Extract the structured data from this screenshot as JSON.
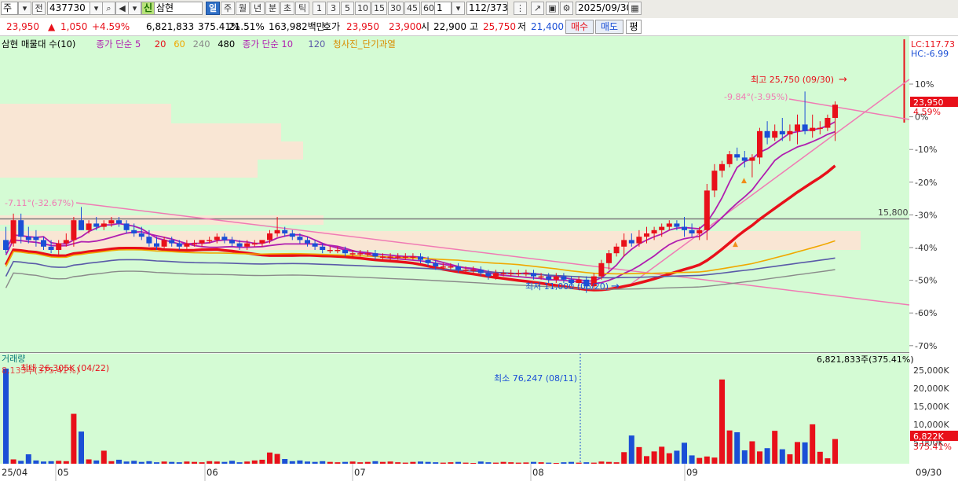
{
  "toolbar": {
    "market_type": "주",
    "prev_label": "전",
    "stock_code": "437730",
    "credit_badge": "신",
    "stock_name": "삼현",
    "periods": [
      "일",
      "주",
      "월",
      "년",
      "분",
      "초",
      "틱"
    ],
    "active_period": "일",
    "intervals": [
      "1",
      "3",
      "5",
      "10",
      "15",
      "30",
      "45",
      "60"
    ],
    "step_value": "1",
    "page_count": "112",
    "page_total": "/373",
    "date": "2025/09/30"
  },
  "quote": {
    "price": "23,950",
    "change_arrow": "▲",
    "change": "1,050",
    "change_rate": "+4.59%",
    "volume": "6,821,833",
    "volume_ratio": "375.41%",
    "turnover": "21.51%",
    "trade_value": "163,982백만",
    "ask_label": "호가",
    "ask": "23,950",
    "bid": "23,900",
    "open_label": "시",
    "open": "22,900",
    "high_label": "고",
    "high": "25,750",
    "low_label": "저",
    "low": "21,400",
    "buy_label": "매수",
    "sell_label": "매도",
    "eval_label": "평"
  },
  "price_panel": {
    "legend": [
      {
        "text": "삼현 매물대 수(10)",
        "color": "#000000"
      },
      {
        "text": "종가 단순 5",
        "color": "#b01eb0"
      },
      {
        "text": "20",
        "color": "#e8101a"
      },
      {
        "text": "60",
        "color": "#f0a800"
      },
      {
        "text": "240",
        "color": "#8a8a8a"
      },
      {
        "text": "480",
        "color": "#000000"
      },
      {
        "text": "종가 단순 10",
        "color": "#b01eb0"
      },
      {
        "text": "120",
        "color": "#5a5aa8"
      },
      {
        "text": "청사진_단기과열",
        "color": "#d98c00"
      }
    ],
    "lc_label": "LC:117.73",
    "hc_label": "HC:-6.99",
    "y_axis_ticks": [
      "10%",
      "0%",
      "-10%",
      "-20%",
      "-30%",
      "-40%",
      "-50%",
      "-60%",
      "-70%"
    ],
    "price_badge": "23,950",
    "rate_badge": "4.59%",
    "hline_label": "15,800",
    "high_annotation": "최고 25,750 (09/30)",
    "low_annotation": "최저 11,000 (08/20)",
    "trend_label_left": "-7.11°(-32.67%)",
    "trend_label_right": "-9.84°(-3.95%)",
    "colors": {
      "up": "#e8101a",
      "down": "#1b4fd6",
      "background": "#d4fbd4"
    }
  },
  "volume_panel": {
    "title": "거래량",
    "max_annotation": "최대 26,305K (04/22)",
    "left_value": "8,133주(375.41%)",
    "right_top_value": "6,821,833주(375.41%)",
    "min_annotation": "최소 76,247 (08/11)",
    "y_axis_ticks": [
      "25,000K",
      "20,000K",
      "15,000K",
      "10,000K",
      "5,000K"
    ],
    "volume_badge": "6,822K",
    "rate_badge": "375.41%"
  },
  "x_axis": {
    "labels": [
      "25/04",
      "05",
      "06",
      "07",
      "08",
      "09",
      "09/30"
    ]
  },
  "chart_data": {
    "type": "candlestick",
    "period": "daily",
    "x_range": [
      "2025/04",
      "2025/09/30"
    ],
    "y_axis": {
      "unit": "% relative",
      "ticks": [
        10,
        0,
        -10,
        -20,
        -30,
        -40,
        -50,
        -60,
        -70
      ]
    },
    "candles_ohlc": [
      {
        "o": -37,
        "h": -33,
        "l": -41,
        "c": -40
      },
      {
        "o": -38,
        "h": -29,
        "l": -39,
        "c": -31
      },
      {
        "o": -31,
        "h": -29,
        "l": -38,
        "c": -36
      },
      {
        "o": -36,
        "h": -33,
        "l": -38,
        "c": -37
      },
      {
        "o": -36,
        "h": -34,
        "l": -39,
        "c": -37
      },
      {
        "o": -37,
        "h": -36,
        "l": -40,
        "c": -39
      },
      {
        "o": -39,
        "h": -37,
        "l": -41,
        "c": -40
      },
      {
        "o": -40,
        "h": -37,
        "l": -42,
        "c": -38
      },
      {
        "o": -38,
        "h": -35,
        "l": -39,
        "c": -37
      },
      {
        "o": -37,
        "h": -30,
        "l": -39,
        "c": -31
      },
      {
        "o": -31,
        "h": -27,
        "l": -34,
        "c": -34
      },
      {
        "o": -34,
        "h": -31,
        "l": -35,
        "c": -32
      },
      {
        "o": -32,
        "h": -30,
        "l": -34,
        "c": -33
      },
      {
        "o": -33,
        "h": -31,
        "l": -34,
        "c": -32
      },
      {
        "o": -32,
        "h": -30,
        "l": -33,
        "c": -31
      },
      {
        "o": -31,
        "h": -30,
        "l": -33,
        "c": -32
      },
      {
        "o": -32,
        "h": -31,
        "l": -35,
        "c": -34
      },
      {
        "o": -34,
        "h": -32,
        "l": -36,
        "c": -35
      },
      {
        "o": -35,
        "h": -33,
        "l": -37,
        "c": -36
      },
      {
        "o": -36,
        "h": -34,
        "l": -39,
        "c": -38
      },
      {
        "o": -38,
        "h": -36,
        "l": -40,
        "c": -39
      },
      {
        "o": -39,
        "h": -36,
        "l": -40,
        "c": -37
      },
      {
        "o": -37,
        "h": -36,
        "l": -39,
        "c": -38
      },
      {
        "o": -38,
        "h": -37,
        "l": -40,
        "c": -39
      },
      {
        "o": -39,
        "h": -37,
        "l": -40,
        "c": -38
      },
      {
        "o": -38,
        "h": -37,
        "l": -39,
        "c": -38
      },
      {
        "o": -38,
        "h": -37,
        "l": -39,
        "c": -37
      },
      {
        "o": -37,
        "h": -36,
        "l": -38,
        "c": -37
      },
      {
        "o": -37,
        "h": -35,
        "l": -38,
        "c": -36
      },
      {
        "o": -36,
        "h": -35,
        "l": -38,
        "c": -37
      },
      {
        "o": -37,
        "h": -36,
        "l": -39,
        "c": -38
      },
      {
        "o": -38,
        "h": -37,
        "l": -40,
        "c": -39
      },
      {
        "o": -39,
        "h": -37,
        "l": -40,
        "c": -38
      },
      {
        "o": -38,
        "h": -37,
        "l": -39,
        "c": -38
      },
      {
        "o": -38,
        "h": -37,
        "l": -39,
        "c": -37
      },
      {
        "o": -37,
        "h": -34,
        "l": -38,
        "c": -35
      },
      {
        "o": -35,
        "h": -30,
        "l": -36,
        "c": -34
      },
      {
        "o": -34,
        "h": -33,
        "l": -36,
        "c": -35
      },
      {
        "o": -35,
        "h": -34,
        "l": -37,
        "c": -36
      },
      {
        "o": -36,
        "h": -35,
        "l": -38,
        "c": -37
      },
      {
        "o": -37,
        "h": -36,
        "l": -39,
        "c": -38
      },
      {
        "o": -38,
        "h": -37,
        "l": -40,
        "c": -39
      },
      {
        "o": -39,
        "h": -38,
        "l": -41,
        "c": -40
      },
      {
        "o": -40,
        "h": -39,
        "l": -41,
        "c": -40
      },
      {
        "o": -40,
        "h": -39,
        "l": -41,
        "c": -40
      },
      {
        "o": -40,
        "h": -39,
        "l": -42,
        "c": -41
      },
      {
        "o": -41,
        "h": -40,
        "l": -42,
        "c": -41
      },
      {
        "o": -41,
        "h": -40,
        "l": -42,
        "c": -41
      },
      {
        "o": -41,
        "h": -40,
        "l": -42,
        "c": -41
      },
      {
        "o": -41,
        "h": -40,
        "l": -43,
        "c": -42
      },
      {
        "o": -42,
        "h": -41,
        "l": -43,
        "c": -42
      },
      {
        "o": -42,
        "h": -41,
        "l": -43,
        "c": -42
      },
      {
        "o": -42,
        "h": -41,
        "l": -43,
        "c": -42
      },
      {
        "o": -42,
        "h": -41,
        "l": -43,
        "c": -42
      },
      {
        "o": -42,
        "h": -41,
        "l": -43,
        "c": -42
      },
      {
        "o": -42,
        "h": -41,
        "l": -44,
        "c": -43
      },
      {
        "o": -43,
        "h": -42,
        "l": -45,
        "c": -44
      },
      {
        "o": -44,
        "h": -43,
        "l": -46,
        "c": -45
      },
      {
        "o": -45,
        "h": -44,
        "l": -46,
        "c": -45
      },
      {
        "o": -45,
        "h": -44,
        "l": -46,
        "c": -45
      },
      {
        "o": -45,
        "h": -44,
        "l": -47,
        "c": -46
      },
      {
        "o": -46,
        "h": -45,
        "l": -47,
        "c": -46
      },
      {
        "o": -46,
        "h": -45,
        "l": -47,
        "c": -46
      },
      {
        "o": -46,
        "h": -45,
        "l": -48,
        "c": -47
      },
      {
        "o": -47,
        "h": -46,
        "l": -49,
        "c": -48
      },
      {
        "o": -48,
        "h": -46,
        "l": -49,
        "c": -47
      },
      {
        "o": -47,
        "h": -46,
        "l": -48,
        "c": -47
      },
      {
        "o": -47,
        "h": -46,
        "l": -48,
        "c": -47
      },
      {
        "o": -47,
        "h": -46,
        "l": -48,
        "c": -47
      },
      {
        "o": -47,
        "h": -46,
        "l": -48,
        "c": -47
      },
      {
        "o": -47,
        "h": -46,
        "l": -49,
        "c": -48
      },
      {
        "o": -48,
        "h": -47,
        "l": -49,
        "c": -48
      },
      {
        "o": -48,
        "h": -47,
        "l": -50,
        "c": -49
      },
      {
        "o": -49,
        "h": -47,
        "l": -50,
        "c": -48
      },
      {
        "o": -48,
        "h": -47,
        "l": -50,
        "c": -49
      },
      {
        "o": -49,
        "h": -48,
        "l": -51,
        "c": -50
      },
      {
        "o": -50,
        "h": -48,
        "l": -51,
        "c": -49
      },
      {
        "o": -49,
        "h": -48,
        "l": -53,
        "c": -51
      },
      {
        "o": -51,
        "h": -47,
        "l": -52,
        "c": -48
      },
      {
        "o": -48,
        "h": -43,
        "l": -49,
        "c": -44
      },
      {
        "o": -44,
        "h": -40,
        "l": -46,
        "c": -41
      },
      {
        "o": -41,
        "h": -38,
        "l": -42,
        "c": -39
      },
      {
        "o": -39,
        "h": -35,
        "l": -42,
        "c": -37
      },
      {
        "o": -37,
        "h": -35,
        "l": -39,
        "c": -38
      },
      {
        "o": -38,
        "h": -34,
        "l": -39,
        "c": -36
      },
      {
        "o": -36,
        "h": -33,
        "l": -38,
        "c": -35
      },
      {
        "o": -35,
        "h": -33,
        "l": -37,
        "c": -34
      },
      {
        "o": -34,
        "h": -32,
        "l": -36,
        "c": -33
      },
      {
        "o": -33,
        "h": -31,
        "l": -34,
        "c": -32
      },
      {
        "o": -32,
        "h": -31,
        "l": -34,
        "c": -33
      },
      {
        "o": -33,
        "h": -30,
        "l": -36,
        "c": -34
      },
      {
        "o": -34,
        "h": -32,
        "l": -36,
        "c": -35
      },
      {
        "o": -35,
        "h": -33,
        "l": -37,
        "c": -34
      },
      {
        "o": -34,
        "h": -20,
        "l": -37,
        "c": -22
      },
      {
        "o": -22,
        "h": -14,
        "l": -24,
        "c": -16
      },
      {
        "o": -16,
        "h": -13,
        "l": -18,
        "c": -14
      },
      {
        "o": -14,
        "h": -10,
        "l": -15,
        "c": -11
      },
      {
        "o": -11,
        "h": -9,
        "l": -13,
        "c": -12
      },
      {
        "o": -12,
        "h": -10,
        "l": -15,
        "c": -13
      },
      {
        "o": -13,
        "h": -11,
        "l": -18,
        "c": -12
      },
      {
        "o": -12,
        "h": -3,
        "l": -14,
        "c": -4
      },
      {
        "o": -4,
        "h": -1,
        "l": -8,
        "c": -6
      },
      {
        "o": -6,
        "h": -2,
        "l": -7,
        "c": -4
      },
      {
        "o": -4,
        "h": 0,
        "l": -7,
        "c": -5
      },
      {
        "o": -5,
        "h": -2,
        "l": -7,
        "c": -4
      },
      {
        "o": -4,
        "h": 1,
        "l": -8,
        "c": -2
      },
      {
        "o": -2,
        "h": 8,
        "l": -5,
        "c": -4
      },
      {
        "o": -4,
        "h": 1,
        "l": -6,
        "c": -3
      },
      {
        "o": -3,
        "h": -1,
        "l": -5,
        "c": -3
      },
      {
        "o": -3,
        "h": 1,
        "l": -4,
        "c": 0
      },
      {
        "o": 0,
        "h": 5,
        "l": -7,
        "c": 4
      }
    ],
    "moving_averages": [
      {
        "name": "5",
        "color": "#b01eb0"
      },
      {
        "name": "10",
        "color": "#b01eb0"
      },
      {
        "name": "20",
        "color": "#e8101a"
      },
      {
        "name": "60",
        "color": "#f0a800"
      },
      {
        "name": "120",
        "color": "#5a5aa8"
      },
      {
        "name": "240",
        "color": "#8a8a8a"
      }
    ],
    "volume_unit": "K",
    "volume_max": 26305,
    "volume_min_k": 76.247,
    "volume_last_k": 6822
  }
}
